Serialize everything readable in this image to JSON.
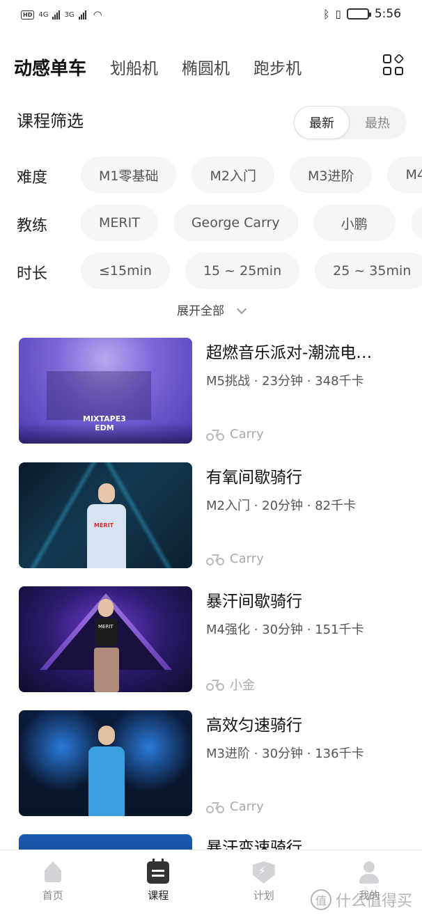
{
  "status_bar": {
    "left_badges": [
      "HD",
      "4G",
      "3G"
    ],
    "time": "5:56"
  },
  "top_tabs": [
    "动感单车",
    "划船机",
    "椭圆机",
    "跑步机"
  ],
  "filter": {
    "title": "课程筛选",
    "sort_options": [
      "最新",
      "最热"
    ],
    "rows": [
      {
        "label": "难度",
        "chips": [
          "M1零基础",
          "M2入门",
          "M3进阶",
          "M4"
        ]
      },
      {
        "label": "教练",
        "chips": [
          "MERIT",
          "George Carry",
          "小鹏",
          ""
        ]
      },
      {
        "label": "时长",
        "chips": [
          "≤15min",
          "15 ~ 25min",
          "25 ~ 35min",
          ""
        ]
      }
    ],
    "expand_label": "展开全部"
  },
  "courses": [
    {
      "title": "超燃音乐派对-潮流电…",
      "meta": "M5挑战 · 23分钟 · 348千卡",
      "coach": "Carry",
      "thumb_text": [
        "MIXTAPE3",
        "EDM"
      ]
    },
    {
      "title": "有氧间歇骑行",
      "meta": "M2入门 · 20分钟 · 82千卡",
      "coach": "Carry",
      "thumb_text": [
        "MERIT"
      ]
    },
    {
      "title": "暴汗间歇骑行",
      "meta": "M4强化 · 30分钟 · 151千卡",
      "coach": "小金",
      "thumb_text": [
        "MERIT"
      ]
    },
    {
      "title": "高效匀速骑行",
      "meta": "M3进阶 · 30分钟 · 136千卡",
      "coach": "Carry",
      "thumb_text": []
    },
    {
      "title": "暴汗变速骑行",
      "meta": "",
      "coach": "",
      "thumb_text": []
    }
  ],
  "bottom_nav": [
    {
      "label": "首页",
      "icon": "home-icon"
    },
    {
      "label": "课程",
      "icon": "calendar-icon"
    },
    {
      "label": "计划",
      "icon": "plan-shield-icon"
    },
    {
      "label": "我的",
      "icon": "profile-icon"
    }
  ],
  "watermark": {
    "badge": "值",
    "text": "什么值得买"
  }
}
